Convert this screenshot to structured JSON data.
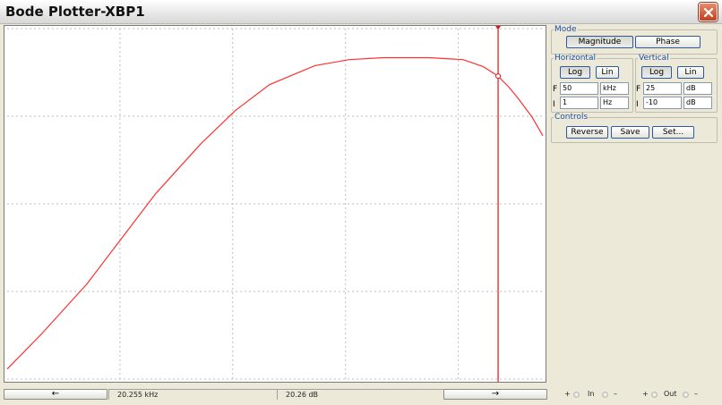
{
  "window": {
    "title": "Bode Plotter-XBP1"
  },
  "mode": {
    "legend": "Mode",
    "magnitude_label": "Magnitude",
    "phase_label": "Phase"
  },
  "horizontal": {
    "legend": "Horizontal",
    "log_label": "Log",
    "lin_label": "Lin",
    "f_label": "F",
    "i_label": "I",
    "f_value": "50",
    "f_unit": "kHz",
    "i_value": "1",
    "i_unit": "Hz"
  },
  "vertical": {
    "legend": "Vertical",
    "log_label": "Log",
    "lin_label": "Lin",
    "f_label": "F",
    "i_label": "I",
    "f_value": "25",
    "f_unit": "dB",
    "i_value": "-10",
    "i_unit": "dB"
  },
  "controls": {
    "legend": "Controls",
    "reverse_label": "Reverse",
    "save_label": "Save",
    "set_label": "Set..."
  },
  "readout": {
    "frequency": "20.255 kHz",
    "gain": "20.26 dB"
  },
  "nav": {
    "left_arrow": "←",
    "right_arrow": "→"
  },
  "terminals": {
    "in_plus": "+",
    "in_label": "In",
    "in_minus": "–",
    "out_plus": "+",
    "out_label": "Out",
    "out_minus": "–"
  },
  "colors": {
    "trace": "#ff3030",
    "cursor": "#e01010",
    "grid": "#bdbdbd"
  },
  "chart_data": {
    "type": "line",
    "x_scale": "log",
    "xlim": [
      1,
      50000
    ],
    "ylim": [
      -10,
      25
    ],
    "grid": true,
    "gridlines_x": 5,
    "gridlines_y": 4,
    "x_unit": "Hz",
    "y_unit": "dB",
    "series": [
      {
        "x": [
          1,
          2,
          5,
          10,
          20,
          50,
          100,
          200,
          500,
          1000,
          2000,
          5000,
          10000,
          15000,
          20000,
          25000,
          30000,
          40000,
          50000
        ],
        "values": [
          -9,
          -5.5,
          -0.5,
          4,
          8.5,
          13.5,
          16.8,
          19.4,
          21.3,
          21.9,
          22.1,
          22.1,
          21.9,
          21.2,
          20.3,
          19.2,
          18.1,
          16.2,
          14.3
        ]
      }
    ],
    "cursor": {
      "x": 20255,
      "y": 20.26
    }
  }
}
